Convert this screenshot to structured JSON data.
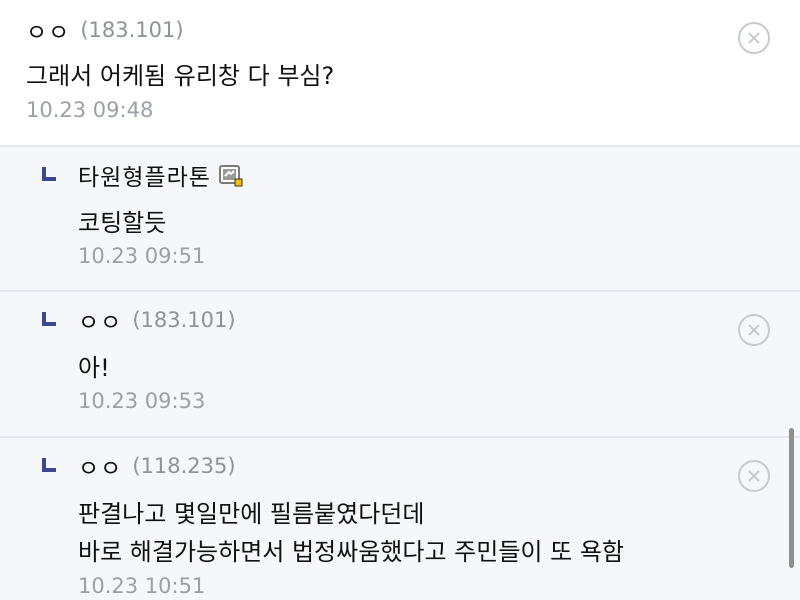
{
  "comments": [
    {
      "author": "ㅇㅇ",
      "ip": "(183.101)",
      "text": "그래서 어케됨 유리창 다 부심?",
      "date": "10.23 09:48",
      "is_reply": false
    },
    {
      "author": "타원형플라톤",
      "text": "코팅할듯",
      "date": "10.23 09:51",
      "is_reply": true,
      "badge_icon": "gallery-member-icon"
    },
    {
      "author": "ㅇㅇ",
      "ip": "(183.101)",
      "text": "아!",
      "date": "10.23 09:53",
      "is_reply": true
    },
    {
      "author": "ㅇㅇ",
      "ip": "(118.235)",
      "text_lines": [
        "판결나고 몇일만에 필름붙였다던데",
        "바로 해결가능하면서 법정싸움했다고 주민들이 또 욕함"
      ],
      "date": "10.23 10:51",
      "is_reply": true
    }
  ],
  "icons": {
    "delete": "close-circle-icon",
    "reply": "reply-arrow-icon"
  },
  "colors": {
    "reply_mark": "#3b4890",
    "reply_bg": "#f5f7fa",
    "muted_text": "#9aa0a6"
  }
}
